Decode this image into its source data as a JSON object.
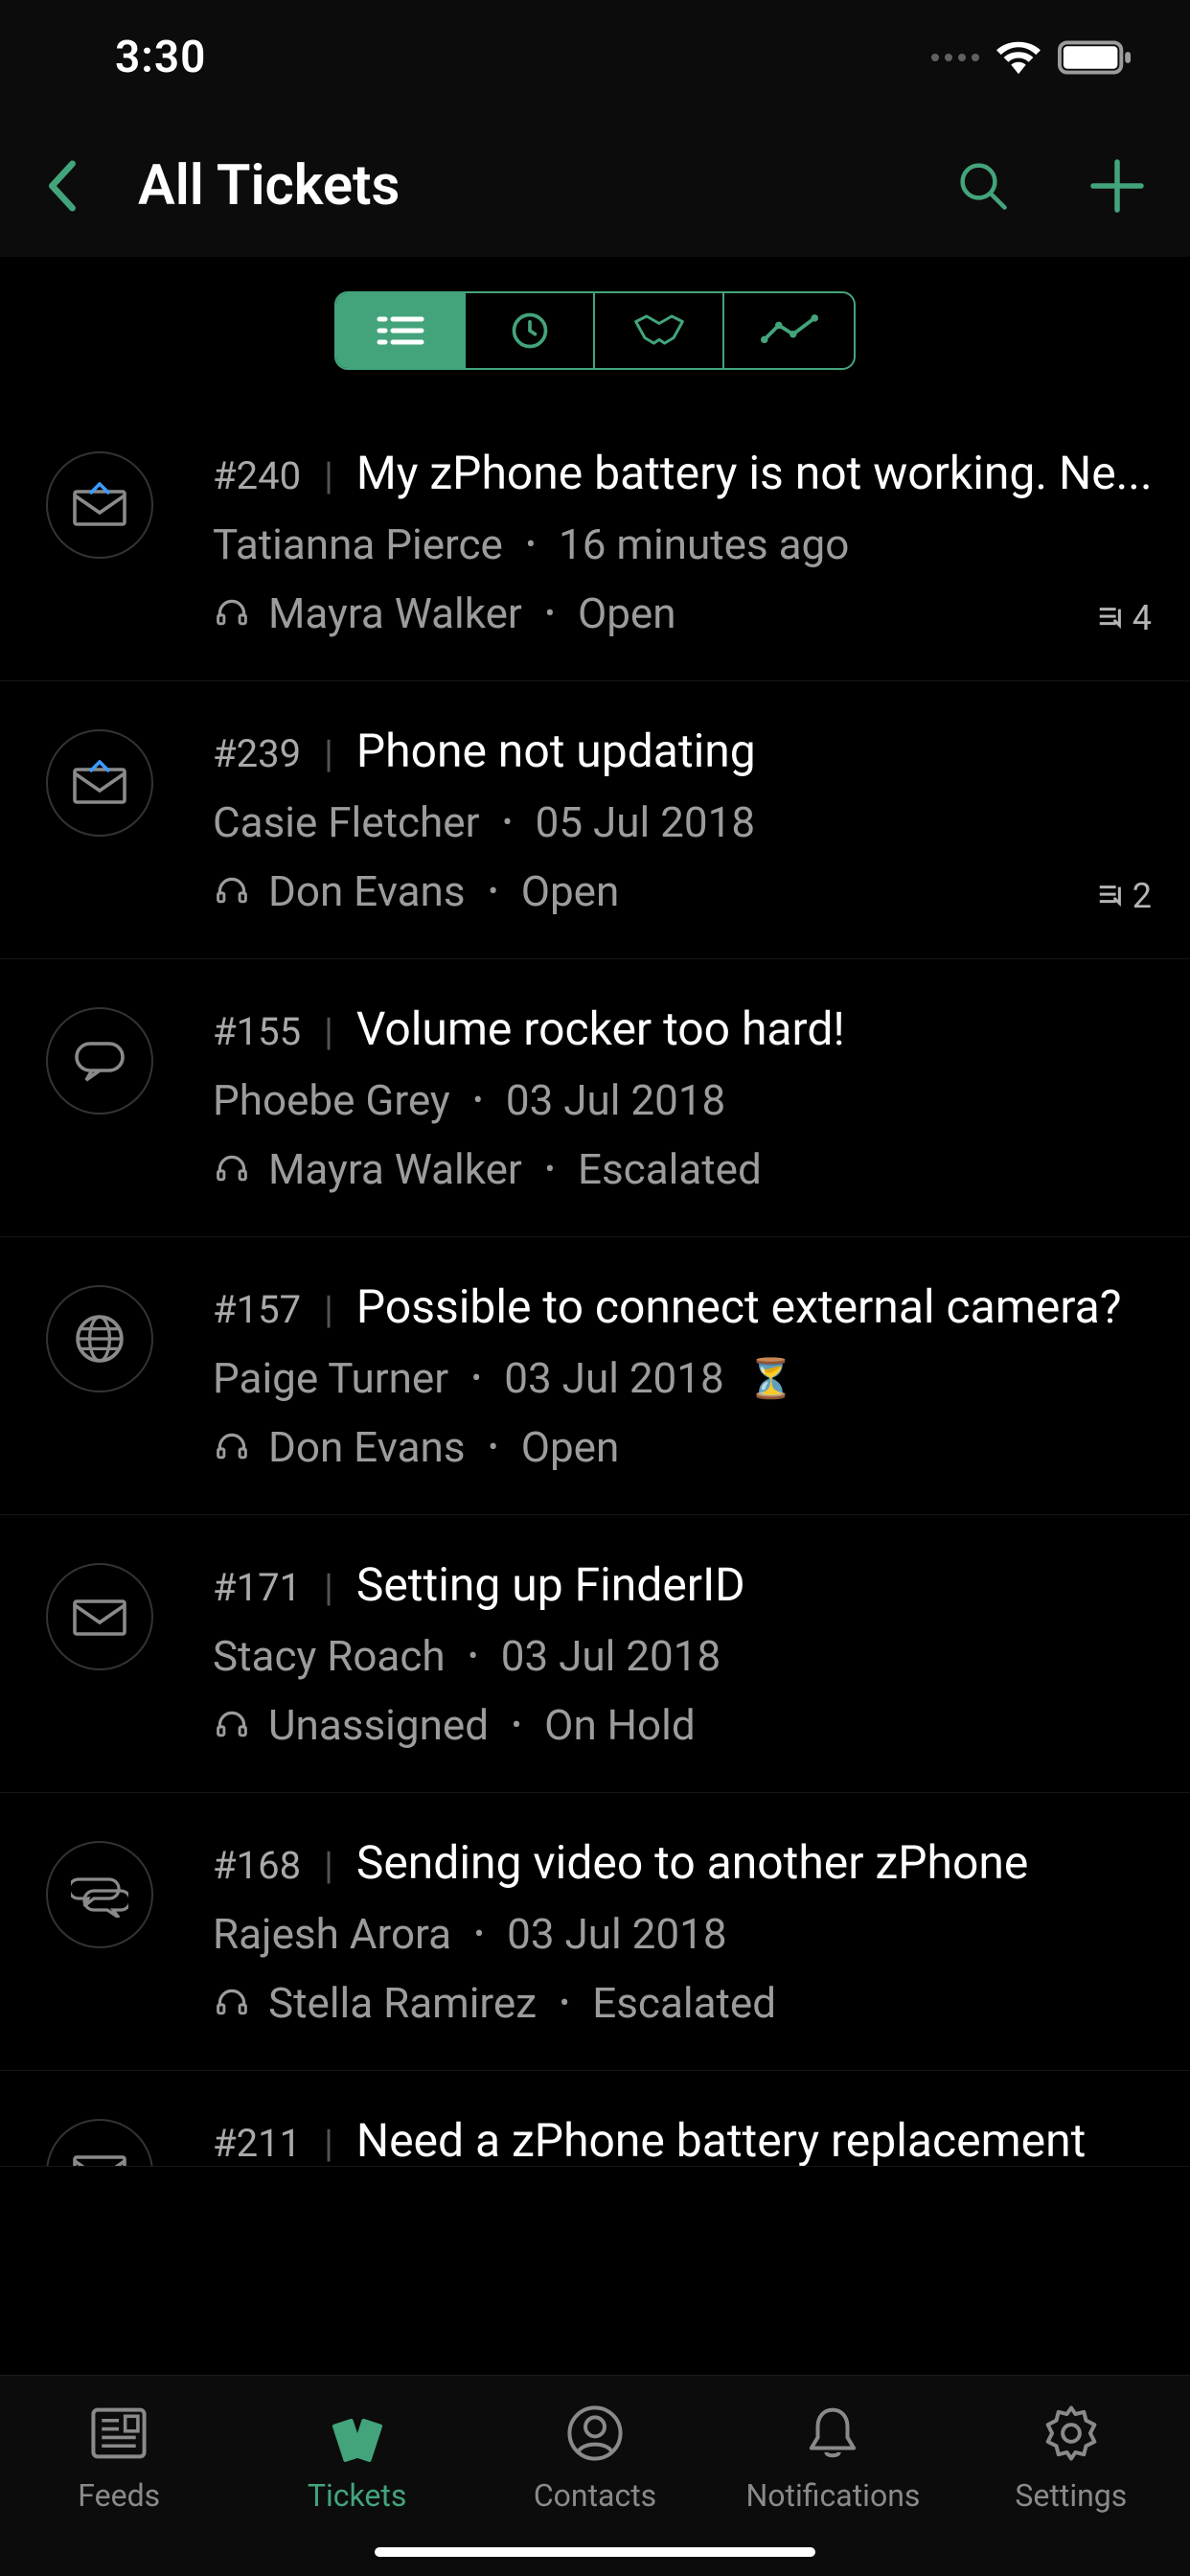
{
  "status": {
    "time": "3:30"
  },
  "header": {
    "title": "All Tickets"
  },
  "tickets": [
    {
      "id": "#240",
      "subject": "My zPhone battery is not working. Ne...",
      "requester": "Tatianna Pierce",
      "date": "16 minutes ago",
      "assignee": "Mayra Walker",
      "status": "Open",
      "channel": "email-new",
      "badge": "4",
      "hourglass": false
    },
    {
      "id": "#239",
      "subject": "Phone not updating",
      "requester": "Casie Fletcher",
      "date": "05 Jul 2018",
      "assignee": "Don Evans",
      "status": "Open",
      "channel": "email-new",
      "badge": "2",
      "hourglass": false
    },
    {
      "id": "#155",
      "subject": "Volume rocker too hard!",
      "requester": "Phoebe Grey",
      "date": "03 Jul 2018",
      "assignee": "Mayra Walker",
      "status": "Escalated",
      "channel": "chat",
      "badge": "",
      "hourglass": false
    },
    {
      "id": "#157",
      "subject": "Possible to connect external camera?",
      "requester": "Paige Turner",
      "date": "03 Jul 2018",
      "assignee": "Don Evans",
      "status": "Open",
      "channel": "web",
      "badge": "",
      "hourglass": true
    },
    {
      "id": "#171",
      "subject": "Setting up FinderID",
      "requester": "Stacy Roach",
      "date": "03 Jul 2018",
      "assignee": "Unassigned",
      "status": "On Hold",
      "channel": "email",
      "badge": "",
      "hourglass": false
    },
    {
      "id": "#168",
      "subject": "Sending video to another zPhone",
      "requester": "Rajesh Arora",
      "date": "03 Jul 2018",
      "assignee": "Stella  Ramirez",
      "status": "Escalated",
      "channel": "chat-multi",
      "badge": "",
      "hourglass": false
    },
    {
      "id": "#211",
      "subject": "Need a zPhone battery replacement",
      "requester": "",
      "date": "",
      "assignee": "",
      "status": "",
      "channel": "email",
      "badge": "",
      "hourglass": false
    }
  ],
  "tabs": {
    "feeds": "Feeds",
    "tickets": "Tickets",
    "contacts": "Contacts",
    "notifications": "Notifications",
    "settings": "Settings"
  },
  "colors": {
    "accent": "#43a47b"
  }
}
